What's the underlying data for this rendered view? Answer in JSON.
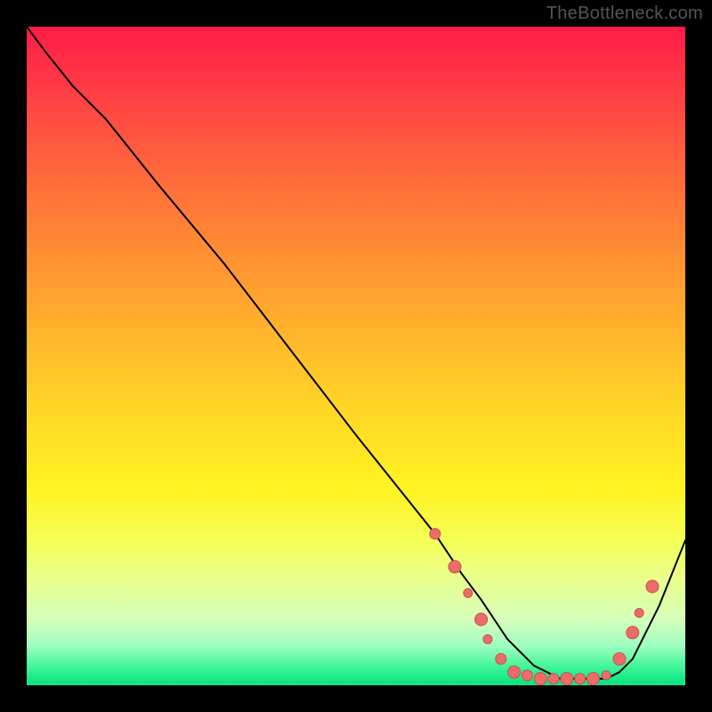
{
  "watermark": "TheBottleneck.com",
  "colors": {
    "marker_fill": "#ec6c6a",
    "marker_stroke": "#c65251",
    "line": "#000000",
    "gradient_top": "#ff1c49",
    "gradient_bottom": "#17e98a"
  },
  "chart_data": {
    "type": "line",
    "title": "",
    "xlabel": "",
    "ylabel": "",
    "xlim": [
      0,
      100
    ],
    "ylim": [
      0,
      100
    ],
    "grid": false,
    "legend": false,
    "series": [
      {
        "name": "curve",
        "x": [
          0,
          3,
          7,
          12,
          20,
          30,
          40,
          50,
          58,
          62,
          66,
          69,
          71,
          73,
          75,
          77,
          79,
          81,
          83,
          85,
          88,
          90,
          92,
          94,
          96,
          98,
          100
        ],
        "y": [
          100,
          96,
          91,
          86,
          76,
          64,
          51,
          38,
          28,
          23,
          17,
          13,
          10,
          7,
          5,
          3,
          2,
          1,
          1,
          1,
          1,
          2,
          4,
          8,
          12,
          17,
          22
        ]
      }
    ],
    "markers": [
      {
        "x": 62,
        "y": 23,
        "r": 6
      },
      {
        "x": 65,
        "y": 18,
        "r": 7
      },
      {
        "x": 67,
        "y": 14,
        "r": 5
      },
      {
        "x": 69,
        "y": 10,
        "r": 7
      },
      {
        "x": 70,
        "y": 7,
        "r": 5
      },
      {
        "x": 72,
        "y": 4,
        "r": 6
      },
      {
        "x": 74,
        "y": 2,
        "r": 7
      },
      {
        "x": 76,
        "y": 1.5,
        "r": 6
      },
      {
        "x": 78,
        "y": 1,
        "r": 7
      },
      {
        "x": 80,
        "y": 1,
        "r": 6
      },
      {
        "x": 82,
        "y": 1,
        "r": 7
      },
      {
        "x": 84,
        "y": 1,
        "r": 6
      },
      {
        "x": 86,
        "y": 1,
        "r": 7
      },
      {
        "x": 88,
        "y": 1.5,
        "r": 5
      },
      {
        "x": 90,
        "y": 4,
        "r": 7
      },
      {
        "x": 92,
        "y": 8,
        "r": 7
      },
      {
        "x": 93,
        "y": 11,
        "r": 5
      },
      {
        "x": 95,
        "y": 15,
        "r": 7
      }
    ]
  }
}
